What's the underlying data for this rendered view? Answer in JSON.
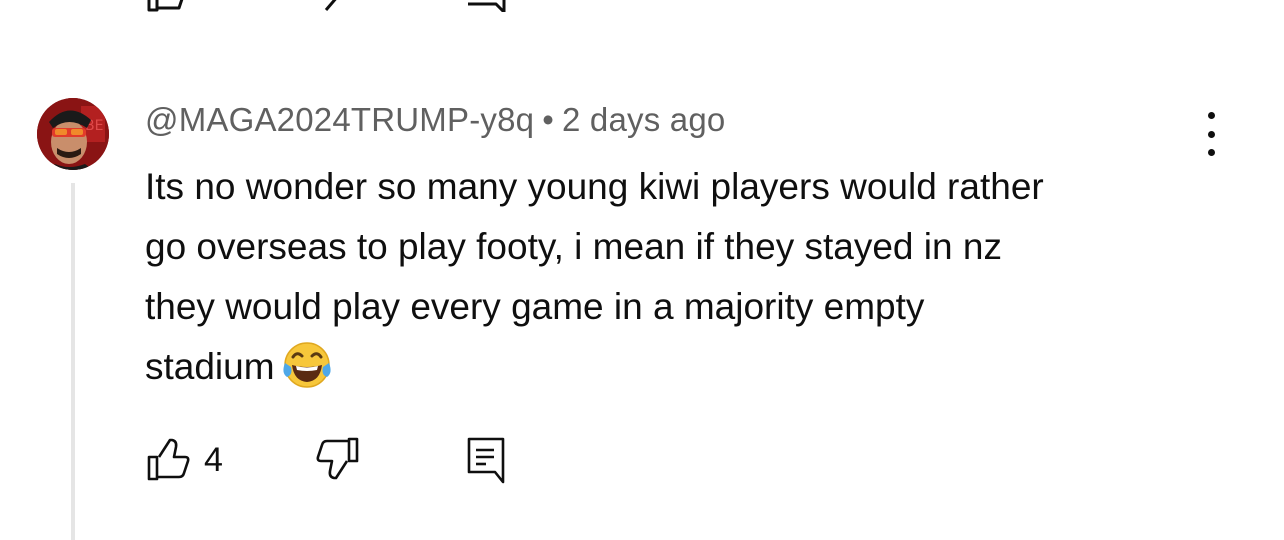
{
  "comment": {
    "author": "@MAGA2024TRUMP-y8q",
    "separator": "•",
    "timestamp": "2 days ago",
    "text_lines": [
      "Its no wonder so many young kiwi players would rather",
      "go overseas to play footy, i mean if they stayed in nz",
      "they would play every game in a majority empty",
      "stadium"
    ],
    "emoji": "face-with-tears-of-joy",
    "like_count": "4"
  },
  "icons": {
    "like": "thumbs-up-icon",
    "dislike": "thumbs-down-icon",
    "reply": "reply-comment-icon",
    "more": "more-vertical-icon"
  },
  "colors": {
    "text": "#0f0f0f",
    "meta": "#606060",
    "thread_line": "#e5e5e5",
    "emoji_face": "#f7c73b",
    "tears": "#4fa8e8"
  }
}
